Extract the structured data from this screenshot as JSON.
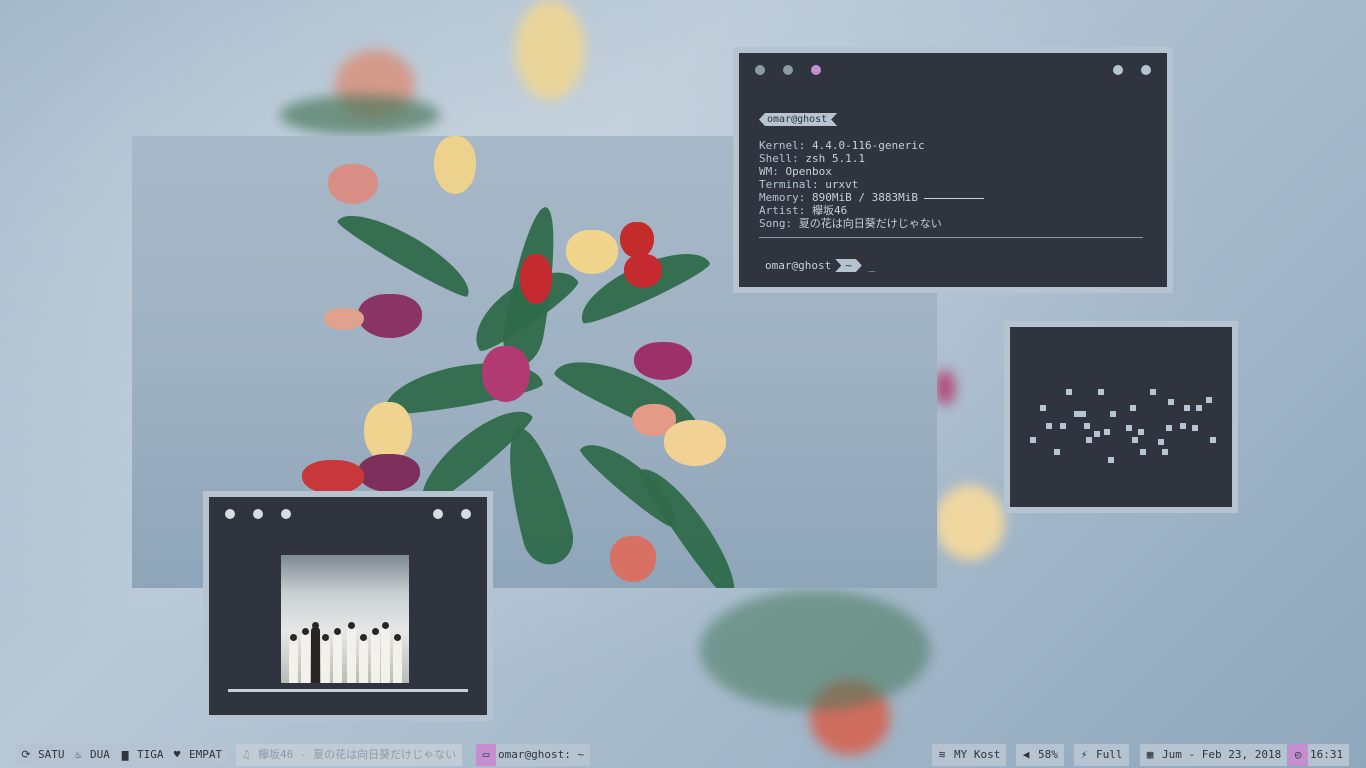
{
  "terminal": {
    "title_user": "omar@ghost",
    "kernel_label": "Kernel:",
    "kernel_value": "4.4.0-116-generic",
    "shell_label": "Shell:",
    "shell_value": "zsh 5.1.1",
    "wm_label": "WM:",
    "wm_value": "Openbox",
    "terminal_label": "Terminal:",
    "terminal_value": "urxvt",
    "memory_label": "Memory:",
    "memory_value": "890MiB / 3883MiB",
    "artist_label": "Artist:",
    "artist_value": "欅坂46",
    "song_label": "Song:",
    "song_value": "夏の花は向日葵だけじゃない",
    "prompt_user": "omar@ghost",
    "prompt_dir": "~",
    "cursor": "_",
    "dot_colors": [
      "#8d99a6",
      "#8d99a6",
      "#c58fcf",
      "#b6c3d1",
      "#b6c3d1"
    ]
  },
  "player": {
    "progress": 1.0,
    "dot_color": "#d8dde3"
  },
  "bar": {
    "workspaces": [
      {
        "icon": "refresh-icon",
        "glyph": "⟳",
        "label": "SATU"
      },
      {
        "icon": "fire-icon",
        "glyph": "♨",
        "label": "DUA"
      },
      {
        "icon": "folder-icon",
        "glyph": "▆",
        "label": "TIGA"
      },
      {
        "icon": "heart-icon",
        "glyph": "♥",
        "label": "EMPAT"
      }
    ],
    "now_playing": {
      "icon": "headphones-icon",
      "glyph": "♫",
      "text": "欅坂46 - 夏の花は向日葵だけじゃない"
    },
    "window_title": {
      "icon": "monitor-icon",
      "glyph": "▭",
      "text": "omar@ghost: ~"
    },
    "wifi": {
      "icon": "wifi-icon",
      "glyph": "≋",
      "text": "MY Kost"
    },
    "volume": {
      "icon": "volume-icon",
      "glyph": "◀",
      "text": "58%"
    },
    "battery": {
      "icon": "plug-icon",
      "glyph": "⚡",
      "text": "Full"
    },
    "date": {
      "icon": "calendar-icon",
      "glyph": "▦",
      "text": "Jum - Feb 23, 2018"
    },
    "clock": {
      "icon": "clock-icon",
      "glyph": "◴",
      "text": "16:31"
    },
    "accent": "#c58fcf",
    "bar_bg": "#b6c3d1"
  }
}
